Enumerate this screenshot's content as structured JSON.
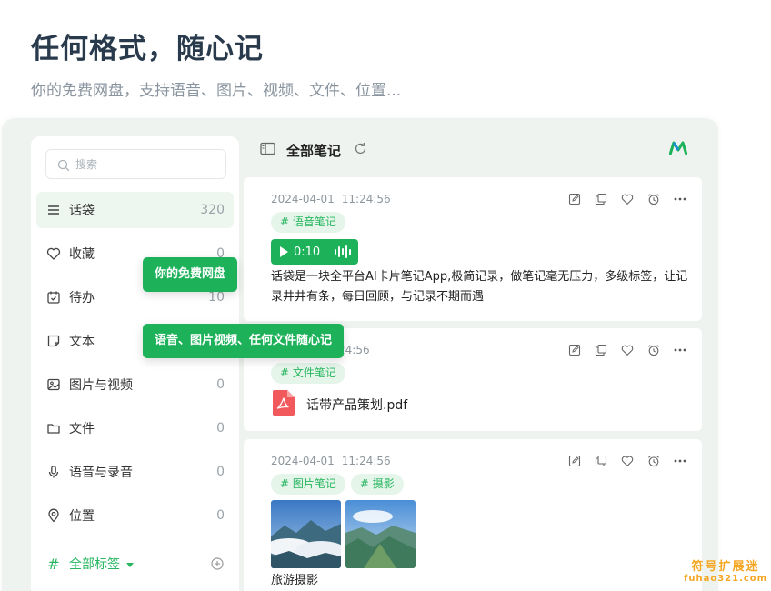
{
  "hero": {
    "title": "任何格式，随心记",
    "subtitle": "你的免费网盘，支持语音、图片、视频、文件、位置..."
  },
  "sidebar": {
    "search_placeholder": "搜索",
    "items": [
      {
        "label": "话袋",
        "count": "320",
        "icon": "list-icon",
        "active": true
      },
      {
        "label": "收藏",
        "count": "0",
        "icon": "heart-icon"
      },
      {
        "label": "待办",
        "count": "10",
        "icon": "calendar-check-icon"
      },
      {
        "label": "文本",
        "count": "",
        "icon": "note-icon"
      },
      {
        "label": "图片与视频",
        "count": "0",
        "icon": "image-icon"
      },
      {
        "label": "文件",
        "count": "0",
        "icon": "folder-icon"
      },
      {
        "label": "语音与录音",
        "count": "0",
        "icon": "microphone-icon"
      },
      {
        "label": "位置",
        "count": "0",
        "icon": "location-pin-icon"
      }
    ],
    "tags_hash": "#",
    "tags_label": "全部标签"
  },
  "toolbar": {
    "title": "全部笔记"
  },
  "notes": [
    {
      "date": "2024-04-01",
      "time": "11:24:56",
      "tags": [
        "# 语音笔记"
      ],
      "audio_duration": "0:10",
      "text": "话袋是一块全平台AI卡片笔记App,极简记录，做笔记毫无压力，多级标签，让记录井井有条，每日回顾，与记录不期而遇"
    },
    {
      "time_partial": "24:56",
      "tags": [
        "# 文件笔记"
      ],
      "file_name": "话带产品策划.pdf"
    },
    {
      "date": "2024-04-01",
      "time": "11:24:56",
      "tags": [
        "# 图片笔记",
        "# 摄影"
      ],
      "caption": "旅游摄影"
    }
  ],
  "tooltips": {
    "first": "你的免费网盘",
    "second": "语音、图片视频、任何文件随心记"
  },
  "watermark": {
    "line1": "符号扩展迷",
    "line2": "fuhao321.com"
  },
  "colors": {
    "accent": "#1db25a",
    "tag_bg": "#e5f5ea",
    "app_bg": "#eef3ef",
    "hero_title": "#283a4c"
  }
}
